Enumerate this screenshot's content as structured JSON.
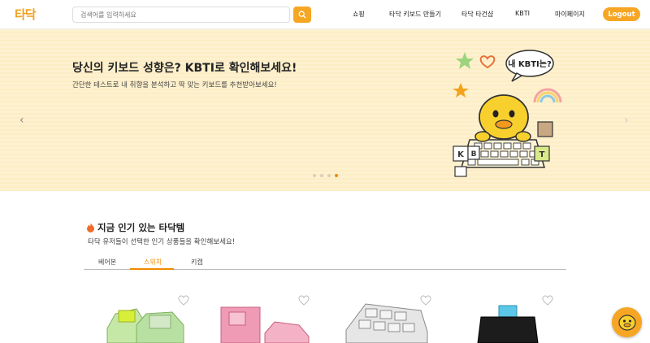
{
  "header": {
    "logo": "타닥",
    "search_placeholder": "검색어를 입력하세요",
    "nav": [
      "쇼핑",
      "타닥 키보드 만들기",
      "타닥 타건샵",
      "KBTI",
      "마이페이지"
    ],
    "logout_label": "Logout"
  },
  "banner": {
    "title": "당신의 키보드 성향은? KBTI로 확인해보세요!",
    "subtitle": "간단한 테스트로 내 취향을 분석하고 딱 맞는 키보드를 추천받아보세요!",
    "bubble_text": "내 KBTI는?",
    "slide_count": 4,
    "active_slide": 4
  },
  "popular": {
    "title": "지금 인기 있는 타닥템",
    "subtitle": "타닥 유저들이 선택한 인기 상품들을 확인해보세요!",
    "tabs": [
      "베어본",
      "스위치",
      "키캡"
    ],
    "active_tab": "스위치"
  },
  "colors": {
    "accent": "#f6a623",
    "accent_text": "#f08a00",
    "banner_bg": "#fdf1cf"
  }
}
